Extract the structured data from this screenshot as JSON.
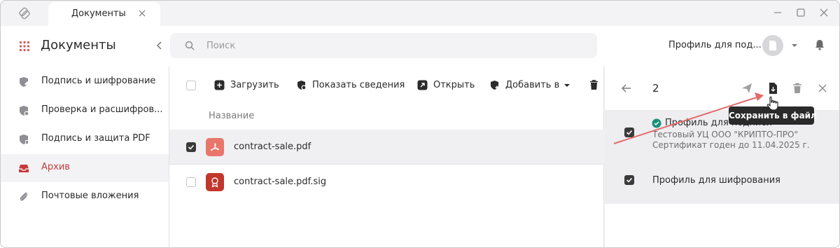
{
  "window": {
    "tab_label": "Документы",
    "minimize_icon": "minimize-icon",
    "maximize_icon": "maximize-icon",
    "close_icon": "close-icon"
  },
  "header": {
    "app_title": "Документы",
    "search_placeholder": "Поиск",
    "profile_label": "Профиль для под..."
  },
  "sidebar": {
    "items": [
      {
        "label": "Подпись и шифрование",
        "icon": "shield-pen-icon",
        "active": false
      },
      {
        "label": "Проверка и расшифров...",
        "icon": "shield-check-icon",
        "active": false
      },
      {
        "label": "Подпись и защита PDF",
        "icon": "shield-pdf-icon",
        "active": false
      },
      {
        "label": "Архив",
        "icon": "archive-icon",
        "active": true
      },
      {
        "label": "Почтовые вложения",
        "icon": "paperclip-icon",
        "active": false
      }
    ]
  },
  "toolbar": {
    "upload_label": "Загрузить",
    "show_info_label": "Показать сведения",
    "open_label": "Открыть",
    "add_to_label": "Добавить в"
  },
  "file_list": {
    "column_header": "Название",
    "rows": [
      {
        "name": "contract-sale.pdf",
        "checked": true,
        "icon": "pdf-icon",
        "color": "#e8766a"
      },
      {
        "name": "contract-sale.pdf.sig",
        "checked": false,
        "icon": "signature-icon",
        "color": "#c2362b"
      }
    ]
  },
  "panel": {
    "count": "2",
    "tooltip": "Сохранить в файл",
    "profiles": [
      {
        "title": "Профиль для подписи",
        "issuer": "Тестовый УЦ ООО \"КРИПТО-ПРО\"",
        "validity": "Сертификат годен до 11.04.2025 г.",
        "checked": true
      },
      {
        "title": "Профиль для шифрования",
        "checked": true
      }
    ]
  },
  "colors": {
    "accent": "#c63b3b",
    "verified": "#1a8f7a",
    "annotation_arrow": "#e36a6a"
  }
}
